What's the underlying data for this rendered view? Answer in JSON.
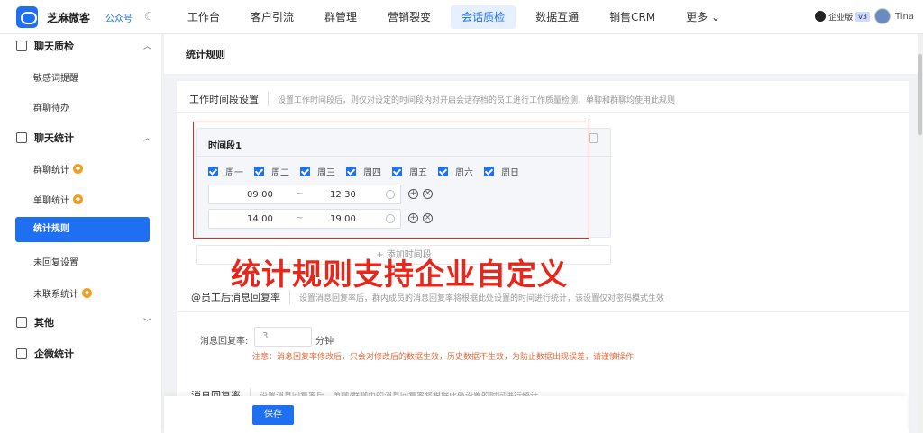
{
  "header": {
    "brand": "芝麻微客",
    "account_type": "公众号",
    "nav": [
      "工作台",
      "客户引流",
      "群管理",
      "营销裂变",
      "会话质检",
      "数据互通",
      "销售CRM",
      "更多"
    ],
    "active_nav": "会话质检",
    "wx_label": "企业版",
    "version": "v3",
    "user_name": "Tina"
  },
  "sidebar": {
    "sections": [
      {
        "label": "聊天质检"
      },
      {
        "label": "聊天统计"
      },
      {
        "label": "其他"
      },
      {
        "label": "企微统计"
      }
    ],
    "items": {
      "sensitive": "敏感词提醒",
      "group_todo": "群聊待办",
      "group_stats": "群聊统计",
      "single_stats": "单聊统计",
      "stat_rules": "统计规则",
      "unreplied": "未回复设置",
      "uncontacted": "未联系统计"
    }
  },
  "page": {
    "title": "统计规则",
    "time_section": {
      "title": "工作时间段设置",
      "desc": "设置工作时间段后，则仅对设定的时间段内对开启会话存档的员工进行工作质量检测，单聊和群聊均使用此规则"
    },
    "period": {
      "title": "时间段1",
      "days": [
        "周一",
        "周二",
        "周三",
        "周四",
        "周五",
        "周六",
        "周日"
      ],
      "ranges": [
        {
          "start": "09:00",
          "sep": "~",
          "end": "12:30"
        },
        {
          "start": "14:00",
          "sep": "~",
          "end": "19:00"
        }
      ],
      "add_label": "+ 添加时间段"
    },
    "overlay_text": "统计规则支持企业自定义",
    "reply_section": {
      "title": "@员工后消息回复率",
      "desc": "设置消息回复率后，群内成员的消息回复率将根据此处设置的时间进行统计，该设置仅对密码模式生效",
      "rate_label": "消息回复率:",
      "rate_value": "3",
      "rate_unit": "分钟",
      "notice": "注意：消息回复率修改后，只会对修改后的数据生效，历史数据不生效，为防止数据出现误差，请谨慎操作"
    },
    "reply2_section": {
      "title": "消息回复率",
      "desc": "设置消息回复率后，单聊/群聊中的消息回复率将根据此处设置的时间进行统计"
    },
    "save_label": "保存"
  },
  "colors": {
    "accent": "#1e6ff1",
    "highlight": "#d93025",
    "overlay": "#e8261a",
    "warning": "#e86a3a"
  }
}
